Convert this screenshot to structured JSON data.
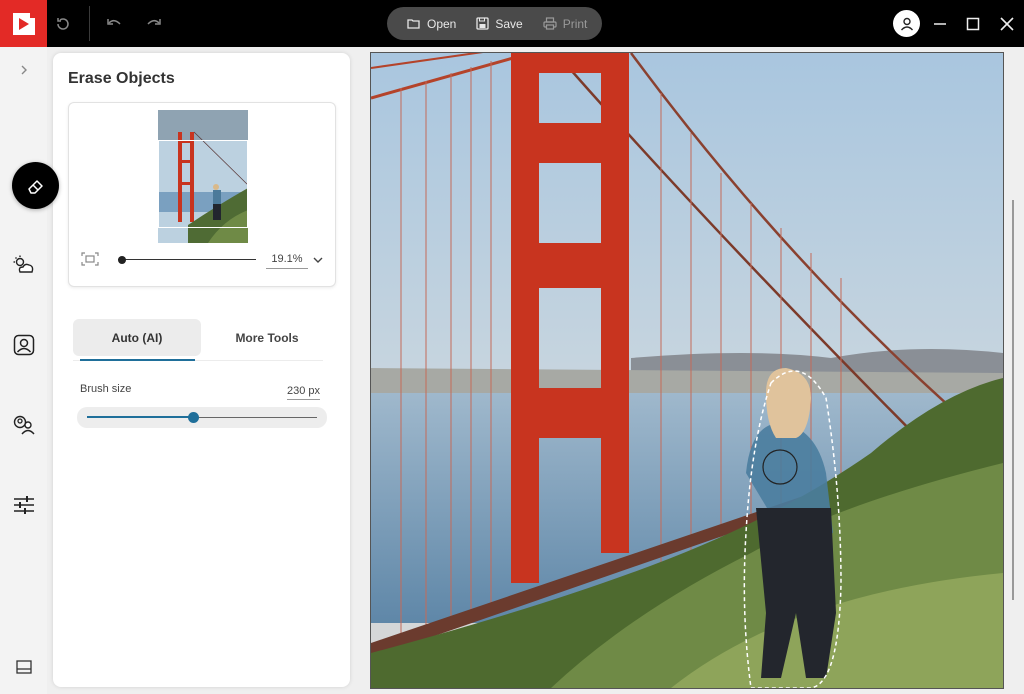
{
  "app": {
    "logo_icon": "play-logo-icon",
    "brand_color": "#e32a26"
  },
  "toolbar": {
    "history_icon": "history-icon",
    "undo_icon": "undo-icon",
    "redo_icon": "redo-icon",
    "open_label": "Open",
    "save_label": "Save",
    "print_label": "Print"
  },
  "window": {
    "account_icon": "account-icon",
    "minimize_icon": "minimize-icon",
    "maximize_icon": "maximize-icon",
    "close_icon": "close-icon"
  },
  "rail": {
    "items": [
      {
        "icon": "expand-chevron-icon"
      },
      {
        "icon": "eraser-icon",
        "active": true
      },
      {
        "icon": "weather-icon"
      },
      {
        "icon": "portrait-icon"
      },
      {
        "icon": "person-swap-icon"
      },
      {
        "icon": "sliders-icon"
      },
      {
        "icon": "panel-bottom-icon"
      }
    ]
  },
  "panel": {
    "title": "Erase Objects",
    "navigator": {
      "zoom_value": "19.1%",
      "zoom_fraction": 0.02
    },
    "tabs": [
      {
        "label": "Auto (AI)",
        "active": true
      },
      {
        "label": "More Tools",
        "active": false
      }
    ],
    "brush": {
      "label": "Brush size",
      "value": "230 px",
      "fraction": 0.46
    }
  },
  "colors": {
    "accent": "#1f6f9a",
    "bridge": "#c8341f"
  }
}
